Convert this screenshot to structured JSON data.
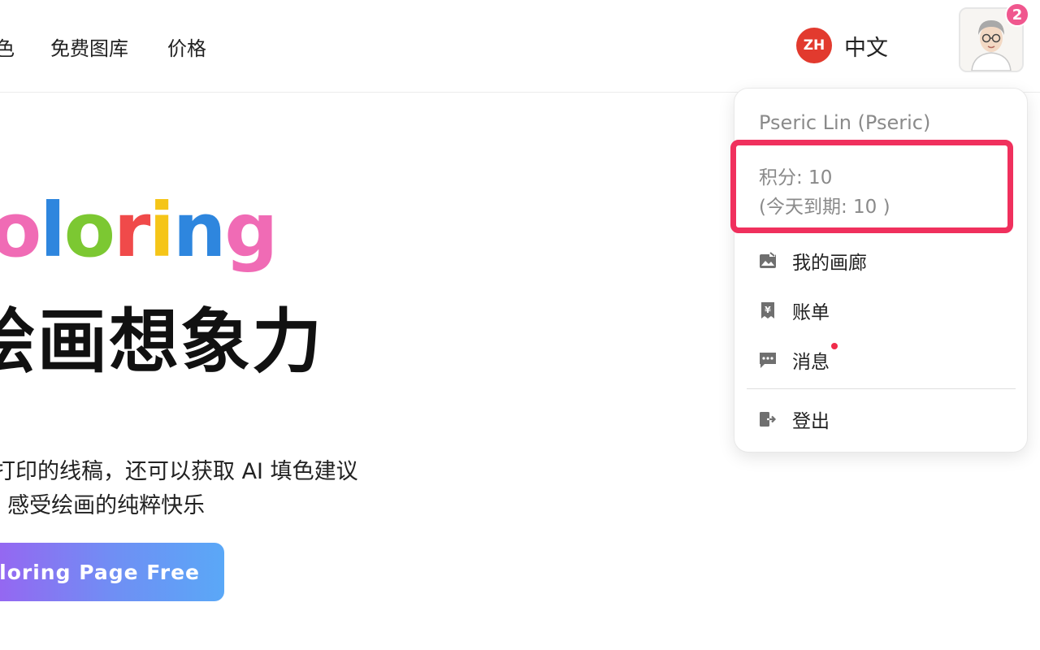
{
  "header": {
    "nav": [
      "色",
      "免费图库",
      "价格"
    ],
    "language": {
      "badge": "ZH",
      "label": "中文"
    },
    "notification_count": "2"
  },
  "hero": {
    "logo_letters": [
      "o",
      "l",
      "o",
      "r",
      "i",
      "n",
      "g"
    ],
    "headline": "绘画想象力",
    "subtitle_line1": "打印的线稿，还可以获取 AI 填色建议",
    "subtitle_line2": "· 感受绘画的纯粹快乐",
    "cta_label": "oloring Page Free"
  },
  "dropdown": {
    "user_name": "Pseric Lin (Pseric)",
    "credits": "积分: 10",
    "expiring": "(今天到期: 10 )",
    "menu": [
      {
        "label": "我的画廊",
        "icon": "gallery-icon"
      },
      {
        "label": "账单",
        "icon": "billing-icon"
      },
      {
        "label": "消息",
        "icon": "message-icon",
        "unread_dot": true
      },
      {
        "label": "登出",
        "icon": "logout-icon"
      }
    ]
  },
  "colors": {
    "accent_red": "#f0305d",
    "lang_badge": "#e23a2e",
    "notif_badge": "#f0578e",
    "logo": [
      "#f06bb5",
      "#2e86de",
      "#7cc832",
      "#f04a4a",
      "#f5c518",
      "#2e86de",
      "#f06bb5"
    ]
  }
}
